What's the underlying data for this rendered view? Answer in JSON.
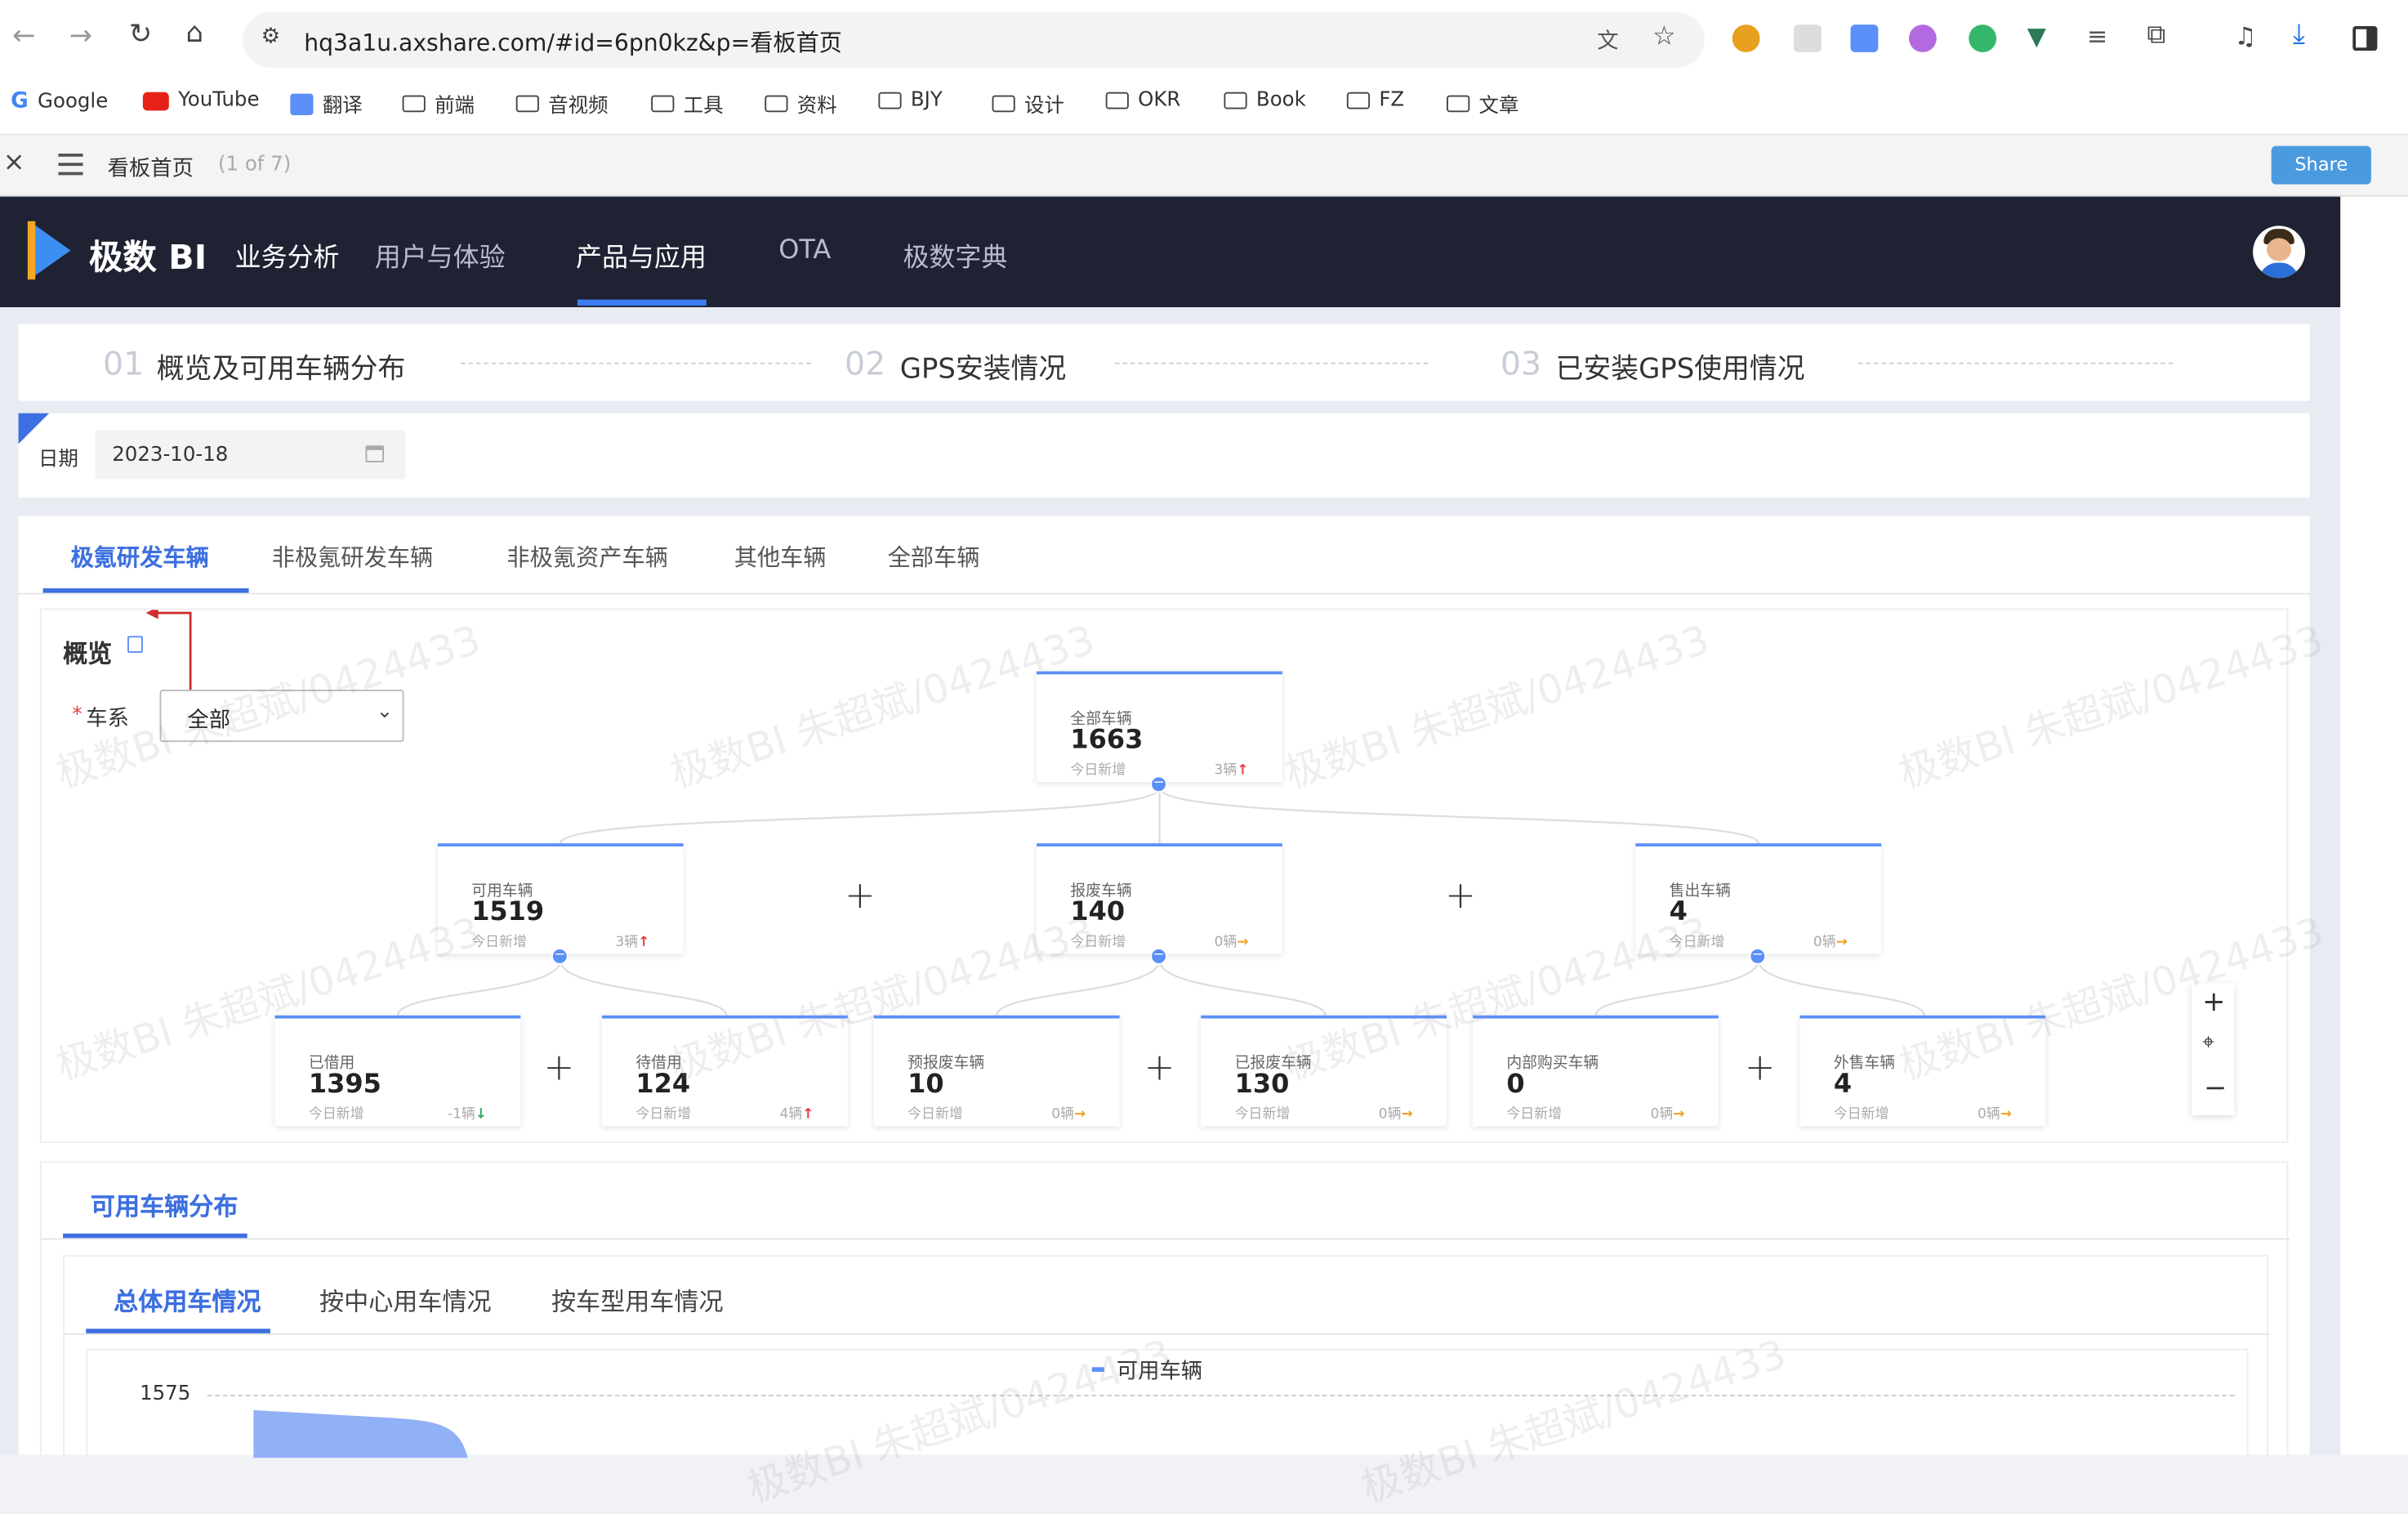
{
  "browser": {
    "url": "hq3a1u.axshare.com/#id=6pn0kz&p=看板首页",
    "bookmarks": [
      "Google",
      "YouTube",
      "翻译",
      "前端",
      "音视频",
      "工具",
      "资料",
      "BJY",
      "设计",
      "OKR",
      "Book",
      "FZ",
      "文章"
    ]
  },
  "axure": {
    "page_title": "看板首页",
    "page_count": "(1 of 7)",
    "share_label": "Share",
    "close": "×"
  },
  "app": {
    "logo": "极数 BI",
    "nav": [
      "业务分析",
      "用户与体验",
      "产品与应用",
      "OTA",
      "极数字典"
    ],
    "active_nav": "产品与应用"
  },
  "steps": [
    {
      "num": "01",
      "label": "概览及可用车辆分布"
    },
    {
      "num": "02",
      "label": "GPS安装情况"
    },
    {
      "num": "03",
      "label": "已安装GPS使用情况"
    }
  ],
  "filter": {
    "date_label": "日期",
    "date_value": "2023-10-18"
  },
  "vehicle_tabs": [
    "极氪研发车辆",
    "非极氪研发车辆",
    "非极氪资产车辆",
    "其他车辆",
    "全部车辆"
  ],
  "overview": {
    "title": "概览",
    "series_label": "车系",
    "series_required": "*",
    "series_value": "全部"
  },
  "tree": {
    "root": {
      "label": "全部车辆",
      "value": "1663",
      "sub": "今日新增",
      "delta": "3辆",
      "trend": "up"
    },
    "level1": [
      {
        "label": "可用车辆",
        "value": "1519",
        "sub": "今日新增",
        "delta": "3辆",
        "trend": "up"
      },
      {
        "label": "报废车辆",
        "value": "140",
        "sub": "今日新增",
        "delta": "0辆",
        "trend": "flat"
      },
      {
        "label": "售出车辆",
        "value": "4",
        "sub": "今日新增",
        "delta": "0辆",
        "trend": "flat"
      }
    ],
    "level2": [
      {
        "label": "已借用",
        "value": "1395",
        "sub": "今日新增",
        "delta": "-1辆",
        "trend": "down"
      },
      {
        "label": "待借用",
        "value": "124",
        "sub": "今日新增",
        "delta": "4辆",
        "trend": "up"
      },
      {
        "label": "预报废车辆",
        "value": "10",
        "sub": "今日新增",
        "delta": "0辆",
        "trend": "flat"
      },
      {
        "label": "已报废车辆",
        "value": "130",
        "sub": "今日新增",
        "delta": "0辆",
        "trend": "flat"
      },
      {
        "label": "内部购买车辆",
        "value": "0",
        "sub": "今日新增",
        "delta": "0辆",
        "trend": "flat"
      },
      {
        "label": "外售车辆",
        "value": "4",
        "sub": "今日新增",
        "delta": "0辆",
        "trend": "flat"
      }
    ]
  },
  "distribution": {
    "title": "可用车辆分布",
    "subtabs": [
      "总体用车情况",
      "按中心用车情况",
      "按车型用车情况"
    ],
    "legend": "可用车辆",
    "y_tick": "1575"
  },
  "watermark": "极数BI 朱超斌/0424433",
  "colors": {
    "accent": "#5b8ff9",
    "header": "#1f2233",
    "active_tab": "#3d6fe0"
  }
}
